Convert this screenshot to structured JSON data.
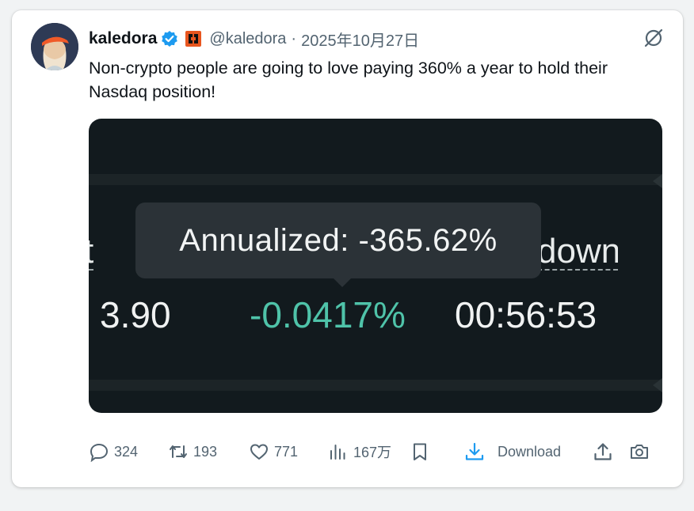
{
  "tweet": {
    "author_name": "kaledora",
    "handle": "@kaledora",
    "separator": "·",
    "date": "2025年10月27日",
    "text": "Non-crypto people are going to love paying 360% a year to hold their Nasdaq position!"
  },
  "media": {
    "partial_label_left": "t",
    "partial_label_right": "down",
    "tooltip": "Annualized: -365.62%",
    "value_left": "3.90",
    "value_mid": "-0.0417%",
    "value_right": "00:56:53",
    "value_mid_color": "#4fc3a9"
  },
  "actions": {
    "replies": "324",
    "retweets": "193",
    "likes": "771",
    "views": "167万",
    "download_label": "Download"
  },
  "icons": [
    "verified-icon",
    "affiliate-badge-icon",
    "grok-icon",
    "reply-icon",
    "retweet-icon",
    "like-icon",
    "views-icon",
    "bookmark-icon",
    "download-icon",
    "share-icon",
    "camera-icon"
  ],
  "colors": {
    "verified": "#1d9bf0",
    "download_accent": "#1d9bf0",
    "affiliate_badge": "#e8561f"
  }
}
